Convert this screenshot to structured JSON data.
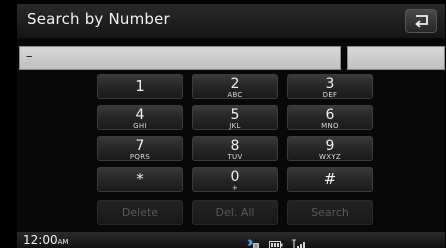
{
  "header": {
    "title": "Search by Number",
    "back_icon": "return-arrow-icon"
  },
  "input": {
    "value": "–",
    "aux_value": ""
  },
  "keypad": {
    "keys": [
      {
        "digit": "1",
        "letters": ""
      },
      {
        "digit": "2",
        "letters": "ABC"
      },
      {
        "digit": "3",
        "letters": "DEF"
      },
      {
        "digit": "4",
        "letters": "GHI"
      },
      {
        "digit": "5",
        "letters": "JKL"
      },
      {
        "digit": "6",
        "letters": "MNO"
      },
      {
        "digit": "7",
        "letters": "PQRS"
      },
      {
        "digit": "8",
        "letters": "TUV"
      },
      {
        "digit": "9",
        "letters": "WXYZ"
      },
      {
        "digit": "*",
        "letters": ""
      },
      {
        "digit": "0",
        "letters": "+"
      },
      {
        "digit": "#",
        "letters": ""
      }
    ],
    "actions": {
      "delete": "Delete",
      "delete_all": "Del. All",
      "search": "Search"
    }
  },
  "statusbar": {
    "time": "12:00",
    "ampm": "AM",
    "icons": [
      "bluetooth-phone-icon",
      "battery-icon",
      "signal-strength-icon"
    ]
  },
  "colors": {
    "background": "#080808",
    "key_text": "#f0f0f0",
    "disabled_text": "#5a5a5a",
    "input_fill": "#cfcfcf"
  }
}
